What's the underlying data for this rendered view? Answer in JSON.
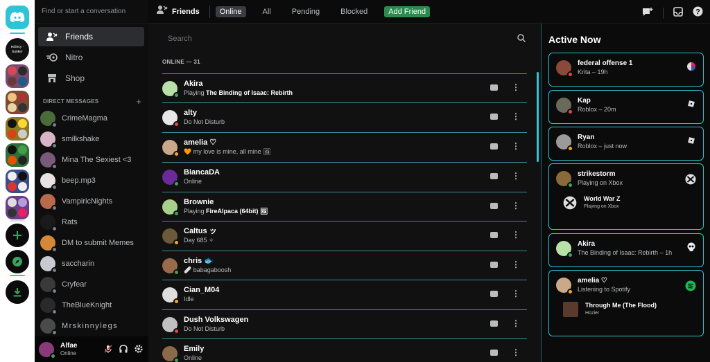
{
  "colors": {
    "accent": "#2ec4d6",
    "online": "#3ba55d",
    "dnd": "#ed4245",
    "idle": "#faa81a",
    "offline": "#747f8d",
    "add_friend": "#2d8a4e"
  },
  "sidebar": {
    "search_placeholder": "Find or start a conversation",
    "nav": [
      {
        "label": "Friends",
        "icon": "friends-icon"
      },
      {
        "label": "Nitro",
        "icon": "nitro-icon"
      },
      {
        "label": "Shop",
        "icon": "shop-icon"
      }
    ],
    "dm_header": "DIRECT MESSAGES",
    "dms": [
      "CrimeMagma",
      "smilkshake",
      "Mina The Sexiest <3",
      "beep.mp3",
      "VampiricNights",
      "Rats",
      "DM to submit Memes",
      "saccharin",
      "Cryfear",
      "TheBlueKnight",
      "Mrskinnylegs"
    ]
  },
  "server_rail": {
    "server1_text": "ectiocy · bunker"
  },
  "user": {
    "name": "Alfae",
    "status": "Online"
  },
  "topbar": {
    "title": "Friends",
    "tabs": [
      "Online",
      "All",
      "Pending",
      "Blocked"
    ],
    "add_friend": "Add Friend"
  },
  "friends": {
    "search_placeholder": "Search",
    "online_header": "ONLINE — 31",
    "list": [
      {
        "name": "Akira",
        "sub_prefix": "Playing ",
        "sub_bold": "The Binding of Isaac: Rebirth",
        "status": "online"
      },
      {
        "name": "alty",
        "sub_prefix": "Do Not Disturb",
        "sub_bold": "",
        "status": "dnd"
      },
      {
        "name": "amelia ♡",
        "sub_prefix": "🧡 my love is mine, all mine 🖼",
        "sub_bold": "",
        "status": "idle"
      },
      {
        "name": "BiancaDA",
        "sub_prefix": "Online",
        "sub_bold": "",
        "status": "online"
      },
      {
        "name": "Brownie",
        "sub_prefix": "Playing ",
        "sub_bold": "FireAlpaca (64bit) 🖼",
        "status": "online"
      },
      {
        "name": "Caltus ッ",
        "sub_prefix": "Day 685 ✧",
        "sub_bold": "",
        "status": "idle"
      },
      {
        "name": "chris 🐟",
        "sub_prefix": "🩹 babagaboosh",
        "sub_bold": "",
        "status": "online"
      },
      {
        "name": "Cian_M04",
        "sub_prefix": "Idle",
        "sub_bold": "",
        "status": "idle"
      },
      {
        "name": "Dush Volkswagen",
        "sub_prefix": "Do Not Disturb",
        "sub_bold": "",
        "status": "dnd"
      },
      {
        "name": "Emily",
        "sub_prefix": "Online",
        "sub_bold": "",
        "status": "online"
      }
    ]
  },
  "active_now": {
    "title": "Active Now",
    "cards": [
      {
        "name": "federal offense 1",
        "sub": "Krita – 19h"
      },
      {
        "name": "Kap",
        "sub": "Roblox – 20m"
      },
      {
        "name": "Ryan",
        "sub": "Roblox – just now"
      },
      {
        "name": "strikestorm",
        "sub": "Playing on Xbox",
        "game": "World War Z",
        "game_sub": "Playing on Xbox"
      },
      {
        "name": "Akira",
        "sub": "The Binding of Isaac: Rebirth – 1h"
      },
      {
        "name": "amelia ♡",
        "sub": "Listening to Spotify",
        "game": "Through Me (The Flood)",
        "game_sub": "Hozier"
      }
    ]
  }
}
